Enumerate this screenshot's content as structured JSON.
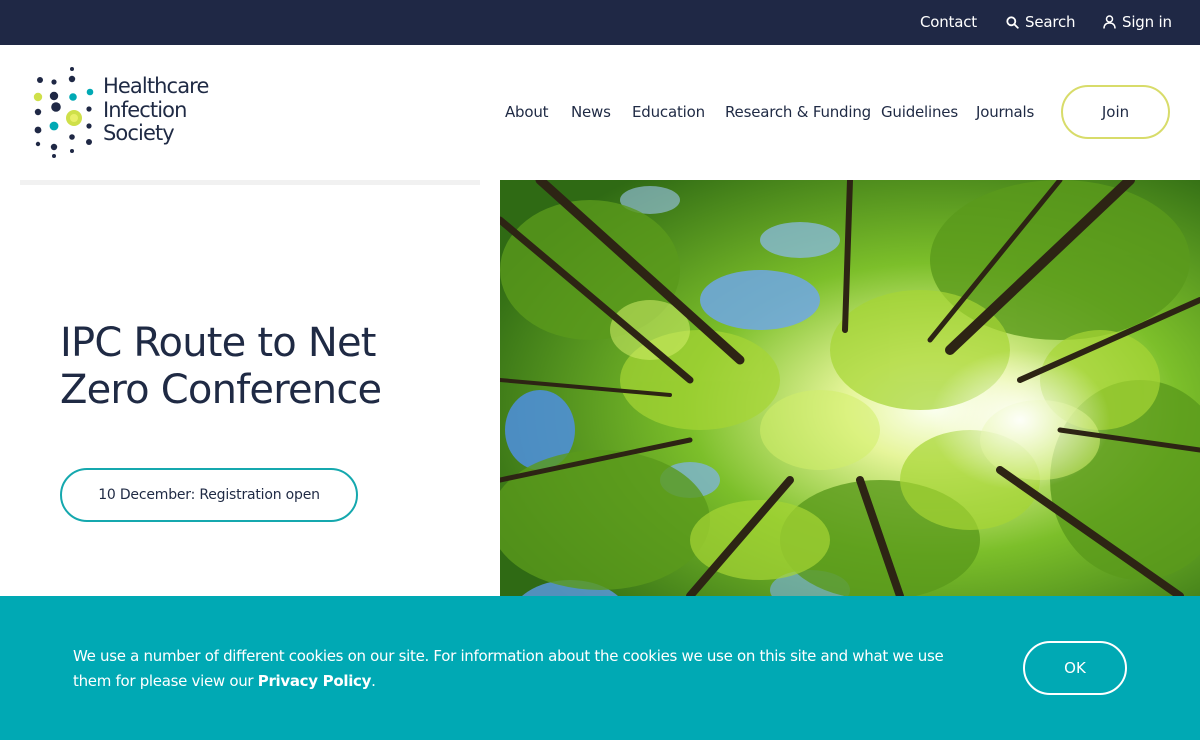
{
  "utility": {
    "contact": "Contact",
    "search": "Search",
    "sign_in": "Sign in"
  },
  "logo": {
    "line1": "Healthcare",
    "line2": "Infection",
    "line3": "Society"
  },
  "nav": {
    "items": [
      "About",
      "News",
      "Education",
      "Research & Funding",
      "Guidelines",
      "Journals"
    ],
    "join": "Join"
  },
  "hero": {
    "title": "IPC Route to Net Zero Conference",
    "cta": "10 December: Registration open",
    "image": "forest-canopy-photo"
  },
  "cookie": {
    "text_before": "We use a number of different cookies on our site. For information about the cookies we use on this site and what we use them for please view our ",
    "link": "Privacy Policy",
    "text_after": ".",
    "ok": "OK"
  },
  "colors": {
    "navy": "#1f2845",
    "teal": "#00a9b4",
    "lime": "#d8dc6a",
    "cta_border": "#15a8ae"
  }
}
